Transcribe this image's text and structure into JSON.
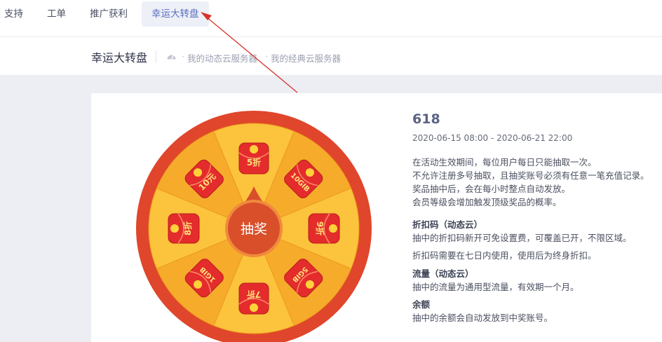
{
  "nav": {
    "items": [
      {
        "label": "支持"
      },
      {
        "label": "工单"
      },
      {
        "label": "推广获利"
      },
      {
        "label": "幸运大转盘"
      }
    ]
  },
  "subheader": {
    "title": "幸运大转盘",
    "breadcrumbs": [
      "我的动态云服务器",
      "我的经典云服务器"
    ]
  },
  "wheel": {
    "button_label": "抽奖",
    "prizes": [
      "5折",
      "10GIB",
      "9折",
      "5GIB",
      "7折",
      "1GIB",
      "8折",
      "10元"
    ],
    "colors": {
      "rim": "#e0462b",
      "slice_light": "#fcc33c",
      "slice_dark": "#f7ab2b",
      "center": "#d94f2a",
      "envelope": "#e42c2c"
    }
  },
  "event": {
    "name": "618",
    "time_range": "2020-06-15 08:00 - 2020-06-21 22:00",
    "rules": [
      "在活动生效期间，每位用户每日只能抽取一次。",
      "不允许注册多号抽取，且抽奖账号必须有任意一笔充值记录。",
      "奖品抽中后，会在每小时整点自动发放。",
      "会员等级会增加触发顶级奖品的概率。"
    ],
    "sections": [
      {
        "title": "折扣码（动态云）",
        "lines": [
          "抽中的折扣码新开可免设置费，可覆盖已开，不限区域。",
          "折扣码需要在七日内使用，使用后为终身折扣。"
        ]
      },
      {
        "title": "流量（动态云）",
        "lines": [
          "抽中的流量为通用型流量，有效期一个月。"
        ]
      },
      {
        "title": "余额",
        "lines": [
          "抽中的余额会自动发放到中奖账号。"
        ]
      }
    ]
  },
  "annotation": {
    "color": "#d9342b"
  }
}
